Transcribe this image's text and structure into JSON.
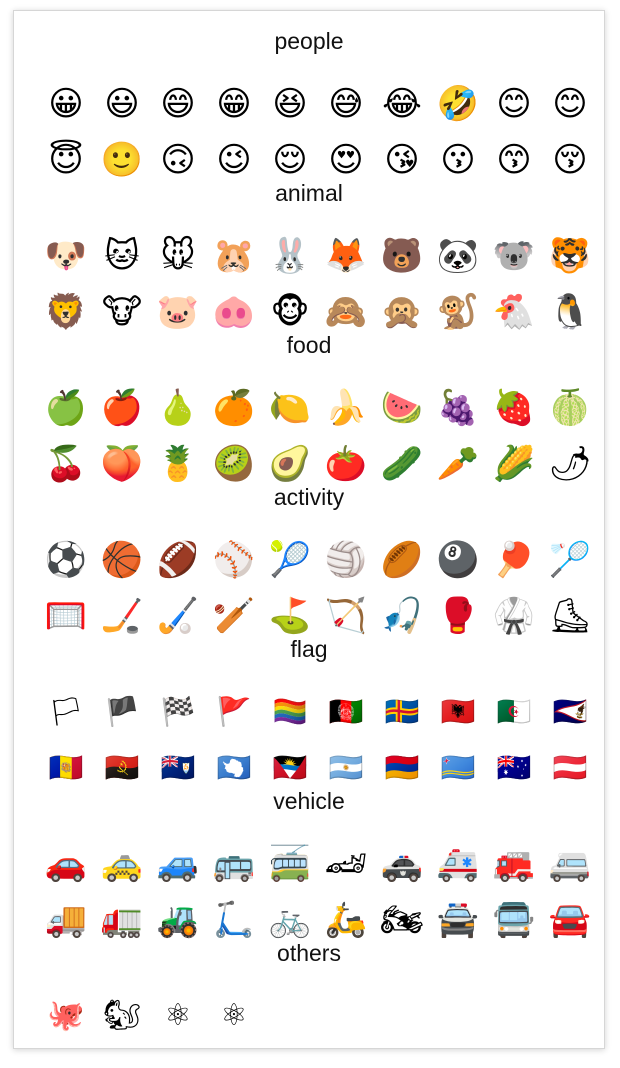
{
  "sections": [
    {
      "title": "people",
      "kind": "emoji",
      "items": [
        "😀",
        "😃",
        "😄",
        "😁",
        "😆",
        "😅",
        "😂",
        "🤣",
        "😊",
        "😊",
        "😇",
        "🙂",
        "🙃",
        "😉",
        "😌",
        "😍",
        "😘",
        "😗",
        "😙",
        "😚"
      ]
    },
    {
      "title": "animal",
      "kind": "emoji",
      "items": [
        "🐶",
        "🐱",
        "🐭",
        "🐹",
        "🐰",
        "🦊",
        "🐻",
        "🐼",
        "🐨",
        "🐯",
        "🦁",
        "🐮",
        "🐷",
        "🐽",
        "🐵",
        "🙈",
        "🙊",
        "🐒",
        "🐔",
        "🐧"
      ]
    },
    {
      "title": "food",
      "kind": "emoji",
      "items": [
        "🍏",
        "🍎",
        "🍐",
        "🍊",
        "🍋",
        "🍌",
        "🍉",
        "🍇",
        "🍓",
        "🍈",
        "🍒",
        "🍑",
        "🍍",
        "🥝",
        "🥑",
        "🍅",
        "🥒",
        "🥕",
        "🌽",
        "🌶"
      ]
    },
    {
      "title": "activity",
      "kind": "emoji",
      "items": [
        "⚽",
        "🏀",
        "🏈",
        "⚾",
        "🎾",
        "🏐",
        "🏉",
        "🎱",
        "🏓",
        "🏸",
        "🥅",
        "🏒",
        "🏑",
        "🏏",
        "⛳",
        "🏹",
        "🎣",
        "🥊",
        "🥋",
        "⛸"
      ]
    },
    {
      "title": "flag",
      "kind": "flag",
      "items": [
        "🏳",
        "🏴",
        "🏁",
        "🚩",
        "🏳️‍🌈",
        "🇦🇫",
        "🇦🇽",
        "🇦🇱",
        "🇩🇿",
        "🇦🇸",
        "🇦🇩",
        "🇦🇴",
        "🇦🇮",
        "🇦🇶",
        "🇦🇬",
        "🇦🇷",
        "🇦🇲",
        "🇦🇼",
        "🇦🇺",
        "🇦🇹"
      ]
    },
    {
      "title": "vehicle",
      "kind": "emoji",
      "items": [
        "🚗",
        "🚕",
        "🚙",
        "🚌",
        "🚎",
        "🏎",
        "🚓",
        "🚑",
        "🚒",
        "🚐",
        "🚚",
        "🚛",
        "🚜",
        "🛴",
        "🚲",
        "🛵",
        "🏍",
        "🚔",
        "🚍",
        "🚘"
      ]
    },
    {
      "title": "others",
      "kind": "logo",
      "items": [
        "🐙",
        "🐿",
        "⚛",
        "⚛"
      ]
    }
  ]
}
